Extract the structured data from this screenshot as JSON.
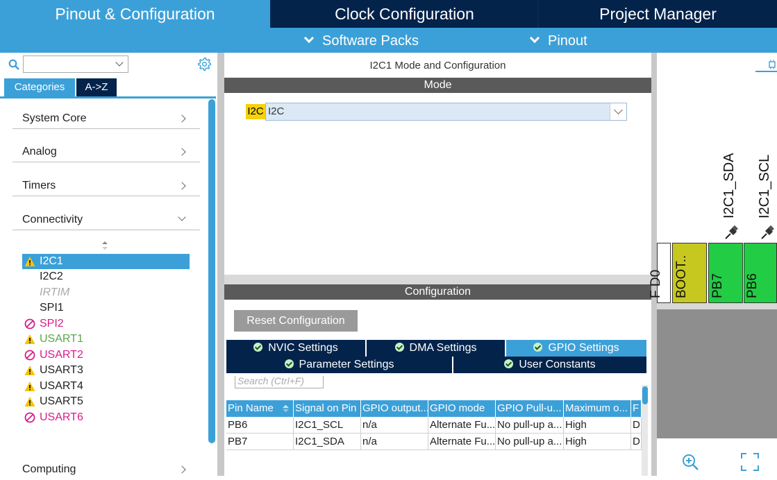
{
  "top_tabs": [
    "Pinout & Configuration",
    "Clock Configuration",
    "Project Manager"
  ],
  "sub_menu": [
    "Software Packs",
    "Pinout"
  ],
  "left": {
    "search_value": "",
    "segments": [
      "Categories",
      "A->Z"
    ],
    "categories": [
      "System Core",
      "Analog",
      "Timers",
      "Connectivity",
      "Computing"
    ],
    "connectivity_items": [
      "I2C1",
      "I2C2",
      "IRTIM",
      "SPI1",
      "SPI2",
      "USART1",
      "USART2",
      "USART3",
      "USART4",
      "USART5",
      "USART6"
    ]
  },
  "middle": {
    "title": "I2C1 Mode and Configuration",
    "mode_header": "Mode",
    "i2c_label": "I2C",
    "i2c_value": "I2C",
    "config_header": "Configuration",
    "reset_button": "Reset Configuration",
    "tabs_row1": [
      "NVIC Settings",
      "DMA Settings",
      "GPIO Settings"
    ],
    "tabs_row2": [
      "Parameter Settings",
      "User Constants"
    ],
    "search_placeholder": "Search (Ctrl+F)",
    "table_headers": [
      "Pin Name",
      "Signal on Pin",
      "GPIO output...",
      "GPIO mode",
      "GPIO Pull-u...",
      "Maximum o...",
      "F"
    ],
    "table_rows": [
      [
        "PB6",
        "I2C1_SCL",
        "n/a",
        "Alternate Fu...",
        "No pull-up a...",
        "High",
        "D"
      ],
      [
        "PB7",
        "I2C1_SDA",
        "n/a",
        "Alternate Fu...",
        "No pull-up a...",
        "High",
        "D"
      ]
    ]
  },
  "right": {
    "signal_labels": [
      "I2C1_SDA",
      "I2C1_SCL"
    ],
    "pins": [
      "F D0",
      "BOOT..",
      "PB7",
      "PB6"
    ]
  },
  "colors": {
    "accent": "#3ca0d8",
    "navy": "#03234b",
    "warning": "#f5c400",
    "error": "#d81b8a",
    "ok_green": "#5aa84a",
    "pin_green": "#22cc44",
    "pin_olive": "#c7c81f"
  }
}
